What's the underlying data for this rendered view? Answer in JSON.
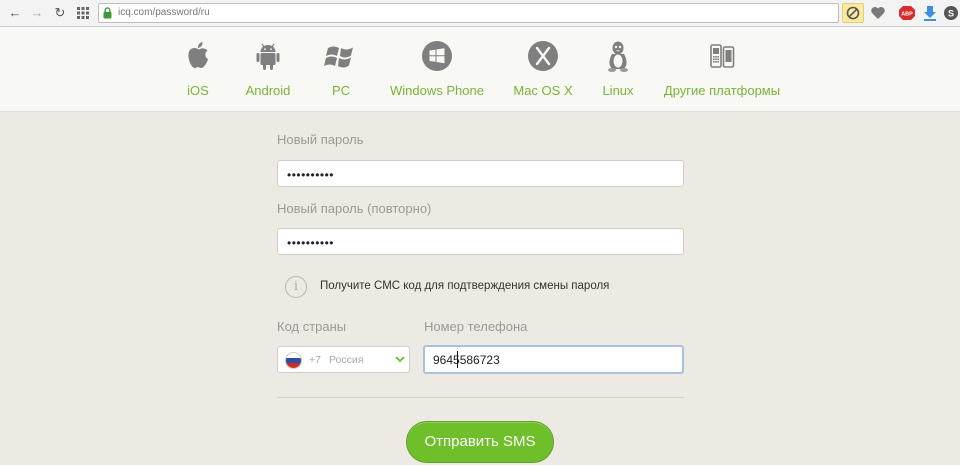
{
  "browser": {
    "url": "icq.com/password/ru",
    "back_icon": "arrow-left-icon",
    "forward_icon": "arrow-right-icon",
    "reload_icon": "reload-icon",
    "apps_icon": "apps-grid-icon",
    "abp_label": "ABP"
  },
  "platforms": [
    {
      "label": "iOS",
      "icon": "apple-icon"
    },
    {
      "label": "Android",
      "icon": "android-icon"
    },
    {
      "label": "PC",
      "icon": "windows-icon"
    },
    {
      "label": "Windows Phone",
      "icon": "windows-phone-icon"
    },
    {
      "label": "Mac OS X",
      "icon": "mac-os-x-icon"
    },
    {
      "label": "Linux",
      "icon": "linux-icon"
    },
    {
      "label": "Другие платформы",
      "icon": "devices-icon"
    }
  ],
  "form": {
    "new_password_label": "Новый пароль",
    "new_password_value": "••••••••••",
    "repeat_password_label": "Новый пароль (повторно)",
    "repeat_password_value": "••••••••••",
    "info_text": "Получите СМС код для подтверждения смены пароля",
    "country_label": "Код страны",
    "country_code": "+7",
    "country_name": "Россия",
    "phone_label": "Номер телефона",
    "phone_value": "9645586723",
    "submit_label": "Отправить SMS"
  },
  "colors": {
    "accent": "#7ab33a",
    "button": "#6fbf2a",
    "background": "#eceae2"
  }
}
